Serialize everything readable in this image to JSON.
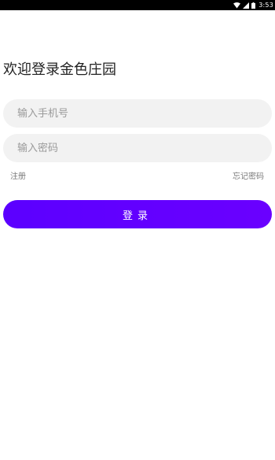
{
  "status_bar": {
    "time": "3:53",
    "icons": [
      "wifi-icon",
      "signal-icon",
      "battery-icon"
    ]
  },
  "login": {
    "title": "欢迎登录金色庄园",
    "phone_placeholder": "输入手机号",
    "password_placeholder": "输入密码",
    "register_label": "注册",
    "forgot_label": "忘记密码",
    "login_button_label": "登录"
  },
  "colors": {
    "button": "#6000ff",
    "field_bg": "#f2f2f2",
    "status_bar": "#000000"
  }
}
